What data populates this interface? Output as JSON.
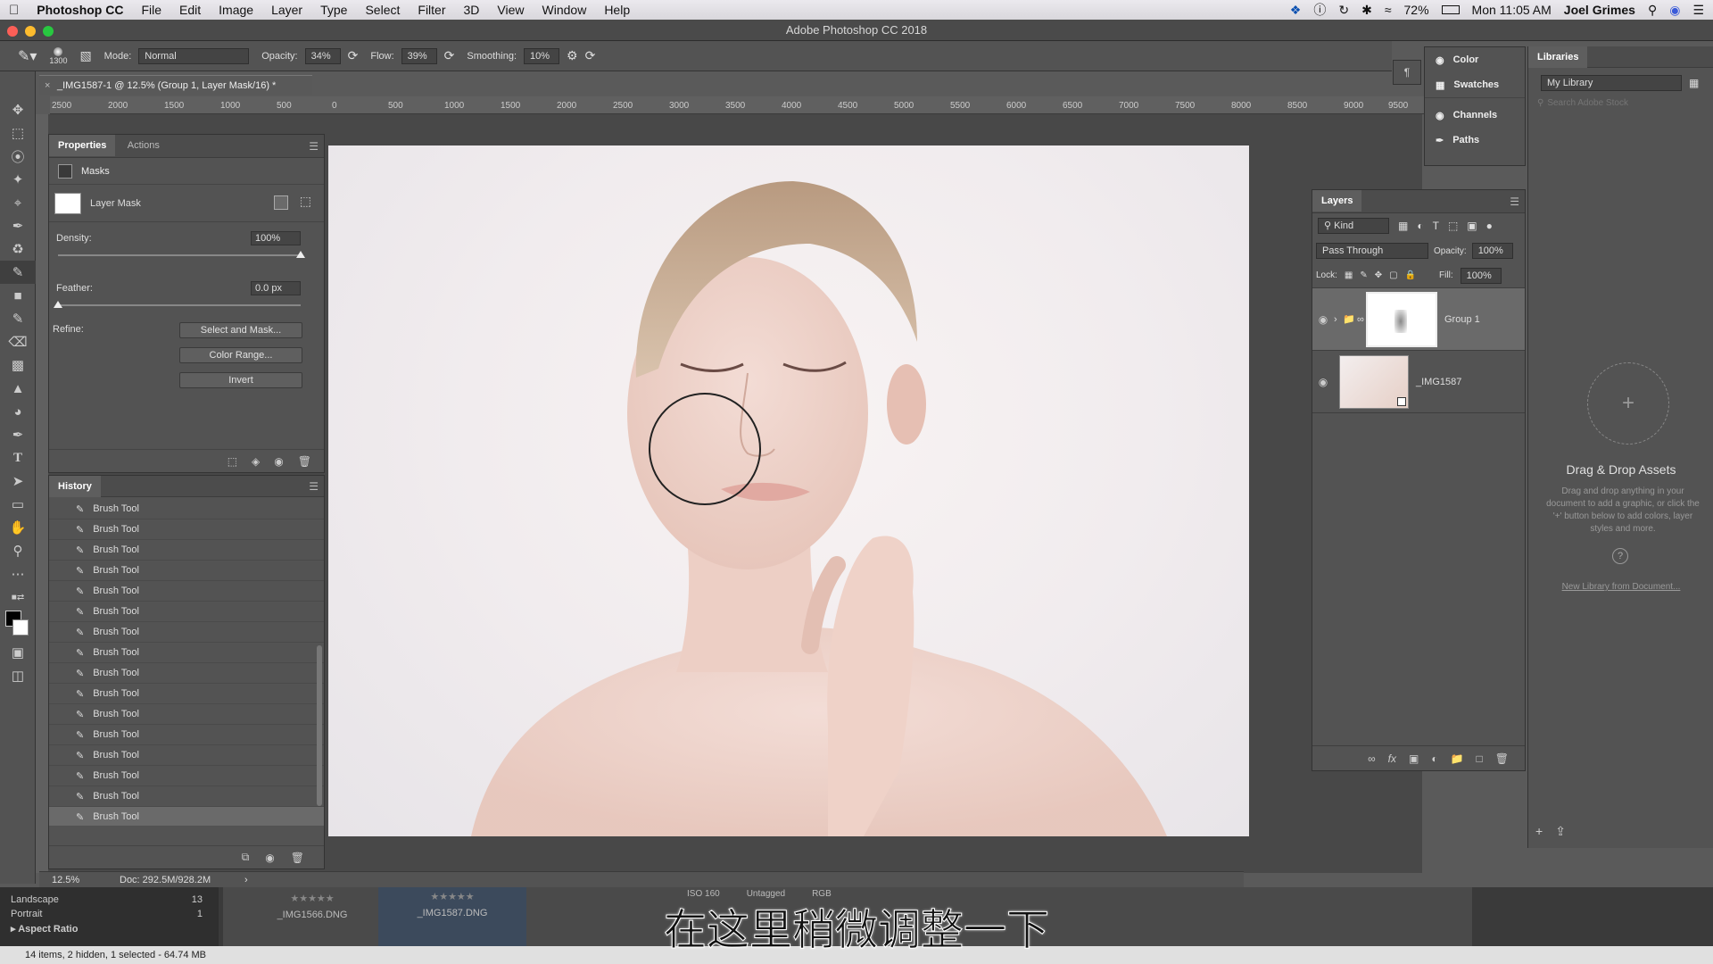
{
  "menubar": {
    "app_name": "Photoshop CC",
    "items": [
      "File",
      "Edit",
      "Image",
      "Layer",
      "Type",
      "Select",
      "Filter",
      "3D",
      "View",
      "Window",
      "Help"
    ],
    "battery": "72%",
    "clock": "Mon 11:05 AM",
    "user": "Joel Grimes"
  },
  "window": {
    "title": "Adobe Photoshop CC 2018"
  },
  "options": {
    "brush_size": "1300",
    "mode_label": "Mode:",
    "mode_value": "Normal",
    "opacity_label": "Opacity:",
    "opacity_value": "34%",
    "flow_label": "Flow:",
    "flow_value": "39%",
    "smoothing_label": "Smoothing:",
    "smoothing_value": "10%"
  },
  "document": {
    "tab_title": "_IMG1587-1 @ 12.5% (Group 1, Layer Mask/16) *",
    "zoom": "12.5%",
    "doc_size": "Doc: 292.5M/928.2M"
  },
  "ruler": {
    "ticks": [
      "2500",
      "2000",
      "1500",
      "1000",
      "500",
      "0",
      "500",
      "1000",
      "1500",
      "2000",
      "2500",
      "3000",
      "3500",
      "4000",
      "4500",
      "5000",
      "5500",
      "6000",
      "6500",
      "7000",
      "7500",
      "8000",
      "8500",
      "9000",
      "9500"
    ]
  },
  "properties": {
    "tabs": [
      "Properties",
      "Actions"
    ],
    "section": "Masks",
    "layer_mask_label": "Layer Mask",
    "density_label": "Density:",
    "density_value": "100%",
    "density_level": 1.0,
    "feather_label": "Feather:",
    "feather_value": "0.0 px",
    "feather_level": 0.0,
    "refine_label": "Refine:",
    "buttons": [
      "Select and Mask...",
      "Color Range...",
      "Invert"
    ]
  },
  "history": {
    "title": "History",
    "items": [
      "Brush Tool",
      "Brush Tool",
      "Brush Tool",
      "Brush Tool",
      "Brush Tool",
      "Brush Tool",
      "Brush Tool",
      "Brush Tool",
      "Brush Tool",
      "Brush Tool",
      "Brush Tool",
      "Brush Tool",
      "Brush Tool",
      "Brush Tool",
      "Brush Tool",
      "Brush Tool"
    ],
    "selected_index": 15
  },
  "dock": {
    "items": [
      {
        "label": "Color",
        "icon": "color-wheel-icon"
      },
      {
        "label": "Swatches",
        "icon": "swatches-grid-icon"
      },
      {
        "label": "Channels",
        "icon": "channels-icon"
      },
      {
        "label": "Paths",
        "icon": "paths-pen-icon"
      }
    ]
  },
  "layers": {
    "title": "Layers",
    "filter_kind": "Kind",
    "blend_mode": "Pass Through",
    "opacity_label": "Opacity:",
    "opacity_value": "100%",
    "lock_label": "Lock:",
    "fill_label": "Fill:",
    "fill_value": "100%",
    "items": [
      {
        "name": "Group 1",
        "type": "group-with-mask",
        "visible": true,
        "selected": true
      },
      {
        "name": "_IMG1587",
        "type": "smart-object",
        "visible": true,
        "selected": false
      }
    ]
  },
  "libraries": {
    "title": "Libraries",
    "library_select": "My Library",
    "search_placeholder": "Search Adobe Stock",
    "empty_title": "Drag & Drop Assets",
    "empty_desc": "Drag and drop anything in your document to add a graphic, or click the '+' button below to add colors, layer styles and more.",
    "new_library_link": "New Library from Document..."
  },
  "lightroom": {
    "filters": [
      {
        "label": "Landscape",
        "count": "13"
      },
      {
        "label": "Portrait",
        "count": "1"
      }
    ],
    "section": "Aspect Ratio",
    "filmstrip": [
      "_IMG1566.DNG",
      "_IMG1587.DNG"
    ],
    "strip_meta": [
      "ISO 160",
      "Untagged",
      "RGB"
    ],
    "status": "14 items, 2 hidden, 1 selected - 64.74 MB"
  },
  "subtitle": "在这里稍微调整一下"
}
